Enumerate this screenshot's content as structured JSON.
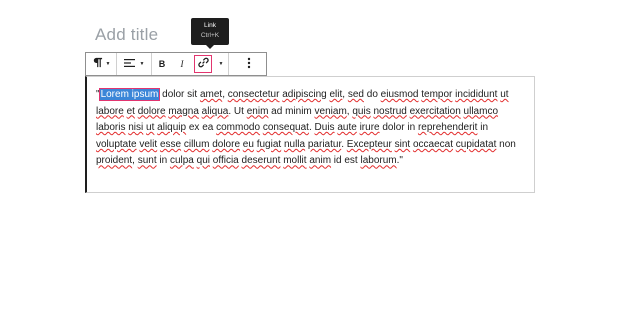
{
  "post": {
    "title_placeholder": "Add title"
  },
  "tooltip": {
    "label": "Link",
    "shortcut": "Ctrl+K"
  },
  "toolbar": {
    "paragraph_icon": "paragraph-icon",
    "align_icon": "align-left-icon",
    "bold_label": "B",
    "italic_label": "I",
    "link_icon": "link-icon",
    "more_icon": "more-vertical-icon"
  },
  "editor": {
    "open_quote": "\"",
    "selected_text": "Lorem ipsum",
    "segments": [
      {
        "t": " dolor sit ",
        "s": false
      },
      {
        "t": "amet",
        "s": true
      },
      {
        "t": ", ",
        "s": false
      },
      {
        "t": "consectetur",
        "s": true
      },
      {
        "t": " ",
        "s": false
      },
      {
        "t": "adipiscing",
        "s": true
      },
      {
        "t": " ",
        "s": false
      },
      {
        "t": "elit",
        "s": true
      },
      {
        "t": ", ",
        "s": false
      },
      {
        "t": "sed",
        "s": true
      },
      {
        "t": " do ",
        "s": false
      },
      {
        "t": "eiusmod",
        "s": true
      },
      {
        "t": " ",
        "s": false
      },
      {
        "t": "tempor",
        "s": true
      },
      {
        "t": " ",
        "s": false
      },
      {
        "t": "incididunt",
        "s": true
      },
      {
        "t": " ",
        "s": false
      },
      {
        "t": "ut",
        "s": true
      },
      {
        "t": " ",
        "s": false
      },
      {
        "t": "labore",
        "s": true
      },
      {
        "t": " ",
        "s": false
      },
      {
        "t": "et",
        "s": true
      },
      {
        "t": " ",
        "s": false
      },
      {
        "t": "dolore",
        "s": true
      },
      {
        "t": " ",
        "s": false
      },
      {
        "t": "magna",
        "s": true
      },
      {
        "t": " ",
        "s": false
      },
      {
        "t": "aliqua",
        "s": true
      },
      {
        "t": ". Ut ",
        "s": false
      },
      {
        "t": "enim",
        "s": true
      },
      {
        "t": " ad minim ",
        "s": false
      },
      {
        "t": "veniam",
        "s": true
      },
      {
        "t": ", ",
        "s": false
      },
      {
        "t": "quis",
        "s": true
      },
      {
        "t": " ",
        "s": false
      },
      {
        "t": "nostrud",
        "s": true
      },
      {
        "t": " ",
        "s": false
      },
      {
        "t": "exercitation",
        "s": true
      },
      {
        "t": " ",
        "s": false
      },
      {
        "t": "ullamco",
        "s": true
      },
      {
        "t": " ",
        "s": false
      },
      {
        "t": "laboris",
        "s": true
      },
      {
        "t": " ",
        "s": false
      },
      {
        "t": "nisi",
        "s": true
      },
      {
        "t": " ",
        "s": false
      },
      {
        "t": "ut",
        "s": true
      },
      {
        "t": " ",
        "s": false
      },
      {
        "t": "aliquip",
        "s": true
      },
      {
        "t": " ex ea ",
        "s": false
      },
      {
        "t": "commodo",
        "s": true
      },
      {
        "t": " ",
        "s": false
      },
      {
        "t": "consequat",
        "s": true
      },
      {
        "t": ". ",
        "s": false
      },
      {
        "t": "Duis",
        "s": true
      },
      {
        "t": " ",
        "s": false
      },
      {
        "t": "aute",
        "s": true
      },
      {
        "t": " ",
        "s": false
      },
      {
        "t": "irure",
        "s": true
      },
      {
        "t": " dolor in ",
        "s": false
      },
      {
        "t": "reprehenderit",
        "s": true
      },
      {
        "t": " in ",
        "s": false
      },
      {
        "t": "voluptate",
        "s": true
      },
      {
        "t": " ",
        "s": false
      },
      {
        "t": "velit",
        "s": true
      },
      {
        "t": " ",
        "s": false
      },
      {
        "t": "esse",
        "s": true
      },
      {
        "t": " ",
        "s": false
      },
      {
        "t": "cillum",
        "s": true
      },
      {
        "t": " ",
        "s": false
      },
      {
        "t": "dolore",
        "s": true
      },
      {
        "t": " ",
        "s": false
      },
      {
        "t": "eu",
        "s": true
      },
      {
        "t": " ",
        "s": false
      },
      {
        "t": "fugiat",
        "s": true
      },
      {
        "t": " ",
        "s": false
      },
      {
        "t": "nulla",
        "s": true
      },
      {
        "t": " ",
        "s": false
      },
      {
        "t": "pariatur",
        "s": true
      },
      {
        "t": ". ",
        "s": false
      },
      {
        "t": "Excepteur",
        "s": true
      },
      {
        "t": " ",
        "s": false
      },
      {
        "t": "sint",
        "s": true
      },
      {
        "t": " ",
        "s": false
      },
      {
        "t": "occaecat",
        "s": true
      },
      {
        "t": " ",
        "s": false
      },
      {
        "t": "cupidatat",
        "s": true
      },
      {
        "t": " non ",
        "s": false
      },
      {
        "t": "proident",
        "s": true
      },
      {
        "t": ", ",
        "s": false
      },
      {
        "t": "sunt",
        "s": true
      },
      {
        "t": " in ",
        "s": false
      },
      {
        "t": "culpa",
        "s": true
      },
      {
        "t": " ",
        "s": false
      },
      {
        "t": "qui",
        "s": true
      },
      {
        "t": " ",
        "s": false
      },
      {
        "t": "officia",
        "s": true
      },
      {
        "t": " ",
        "s": false
      },
      {
        "t": "deserunt",
        "s": true
      },
      {
        "t": " ",
        "s": false
      },
      {
        "t": "mollit",
        "s": true
      },
      {
        "t": " ",
        "s": false
      },
      {
        "t": "anim",
        "s": true
      },
      {
        "t": " id est ",
        "s": false
      },
      {
        "t": "laborum",
        "s": true
      },
      {
        "t": ".\"",
        "s": false
      }
    ]
  },
  "colors": {
    "accent_outline": "#e2356f",
    "selection": "#3b86d8",
    "spellcheck": "#e22b2b"
  }
}
